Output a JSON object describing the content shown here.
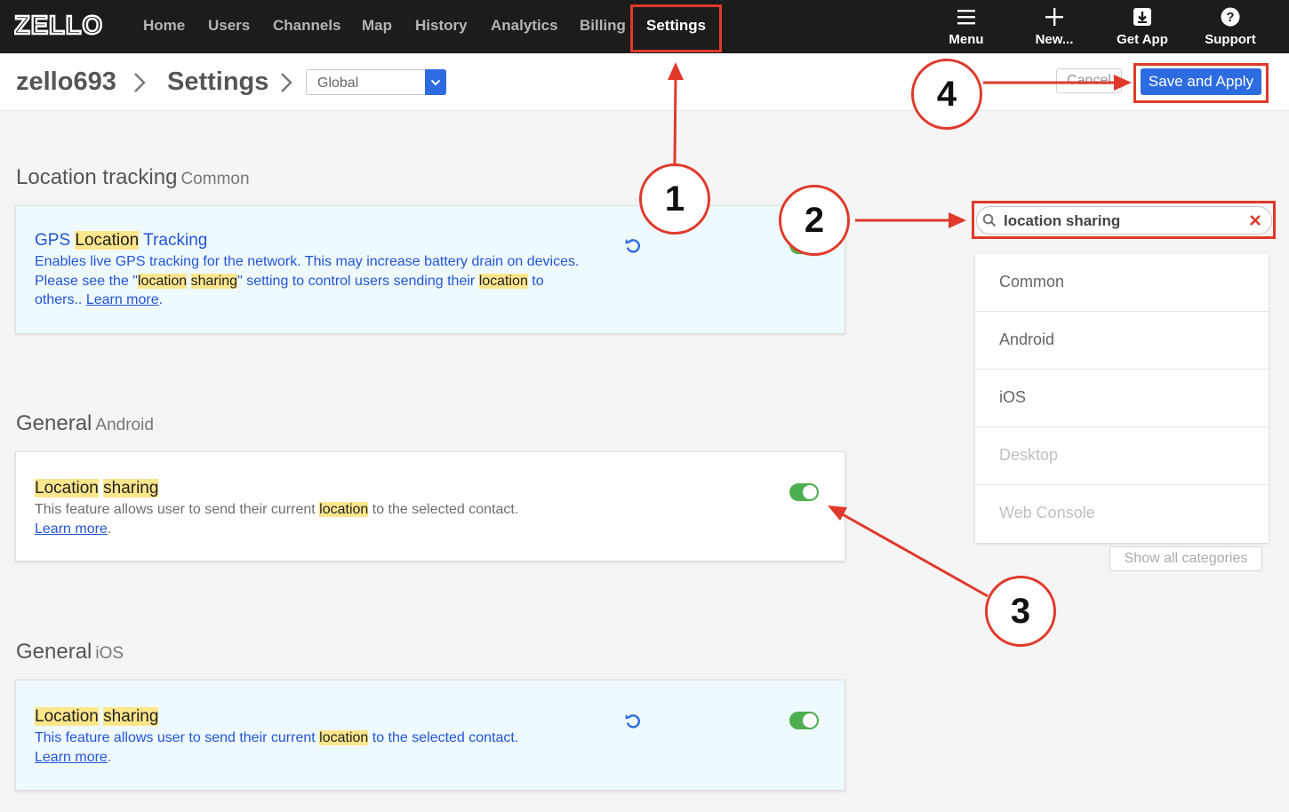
{
  "app": {
    "logo_text": "ZELLO"
  },
  "nav": {
    "items": [
      {
        "label": "Home",
        "active": false
      },
      {
        "label": "Users",
        "active": false
      },
      {
        "label": "Channels",
        "active": false
      },
      {
        "label": "Map",
        "active": false
      },
      {
        "label": "History",
        "active": false
      },
      {
        "label": "Analytics",
        "active": false
      },
      {
        "label": "Billing",
        "active": false
      },
      {
        "label": "Settings",
        "active": true
      }
    ],
    "tools": [
      {
        "label": "Menu",
        "icon": "hamburger-icon"
      },
      {
        "label": "New...",
        "icon": "plus-icon"
      },
      {
        "label": "Get App",
        "icon": "download-icon"
      },
      {
        "label": "Support",
        "icon": "help-icon"
      }
    ]
  },
  "header": {
    "account": "zello693",
    "page": "Settings",
    "scope_value": "Global",
    "cancel_label": "Cancel",
    "save_label": "Save and Apply"
  },
  "sections": [
    {
      "title": "Location tracking",
      "subtitle": "Common",
      "setting": {
        "title_parts": [
          "GPS ",
          "Location",
          " Tracking"
        ],
        "desc_line1": "Enables live GPS tracking for the network. This may increase battery drain on devices.",
        "desc_line2_parts": [
          "Please see the \"",
          "location",
          " ",
          "sharing",
          "\" setting to control users sending their ",
          "location",
          " to"
        ],
        "desc_line3": "others.. ",
        "learn_more": "Learn more",
        "enabled": true
      }
    },
    {
      "title": "General",
      "subtitle": "Android",
      "setting": {
        "title_parts": [
          "Location",
          " ",
          "sharing"
        ],
        "desc_parts": [
          "This feature allows user to send their current ",
          "location",
          " to the selected contact."
        ],
        "learn_more": "Learn more",
        "enabled": true
      }
    },
    {
      "title": "General",
      "subtitle": "iOS",
      "setting": {
        "title_parts": [
          "Location",
          " ",
          "sharing"
        ],
        "desc_parts": [
          "This feature allows user to send their current ",
          "location",
          " to the selected contact."
        ],
        "learn_more": "Learn more",
        "enabled": true
      }
    }
  ],
  "sidebar": {
    "search_query": "location sharing",
    "categories": [
      {
        "label": "Common",
        "enabled": true
      },
      {
        "label": "Android",
        "enabled": true
      },
      {
        "label": "iOS",
        "enabled": true
      },
      {
        "label": "Desktop",
        "enabled": false
      },
      {
        "label": "Web Console",
        "enabled": false
      }
    ],
    "show_all_label": "Show all categories"
  },
  "annotations": {
    "markers": [
      "1",
      "2",
      "3",
      "4"
    ],
    "color": "#e0392b"
  },
  "colors": {
    "accent": "#2d6be0",
    "highlight": "#fde68c",
    "toggle_on": "#4caf50",
    "navbar": "#1c1c1c"
  }
}
